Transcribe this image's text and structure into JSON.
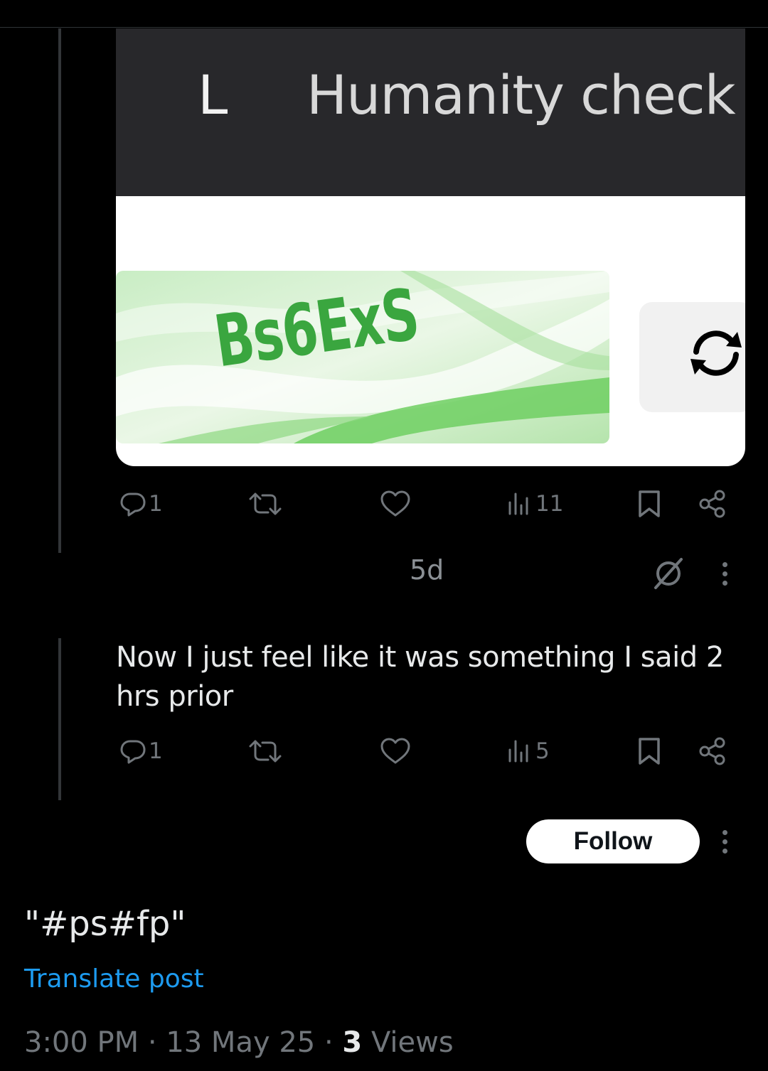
{
  "media": {
    "dialog_back": "L",
    "dialog_title": "Humanity check",
    "captcha_text": "Bs6ExS",
    "refresh_icon": "refresh-icon"
  },
  "first_reply": {
    "actions": {
      "reply_count": "1",
      "repost_count": "",
      "like_count": "",
      "views_count": "11"
    }
  },
  "second_reply": {
    "time": "5d",
    "text": "Now I just feel like it was something I said 2 hrs prior",
    "actions": {
      "reply_count": "1",
      "repost_count": "",
      "like_count": "",
      "views_count": "5"
    }
  },
  "main_post": {
    "follow_label": "Follow",
    "text": "\"#ps#fp\"",
    "translate_label": "Translate post",
    "meta_prefix": "3:00 PM · 13 May 25 · ",
    "views_number": "3",
    "views_label": " Views"
  },
  "colors": {
    "background": "#000000",
    "text_primary": "#e7e9ea",
    "text_secondary": "#71767b",
    "link": "#1d9bf0",
    "captcha_green": "#3aa63f"
  }
}
